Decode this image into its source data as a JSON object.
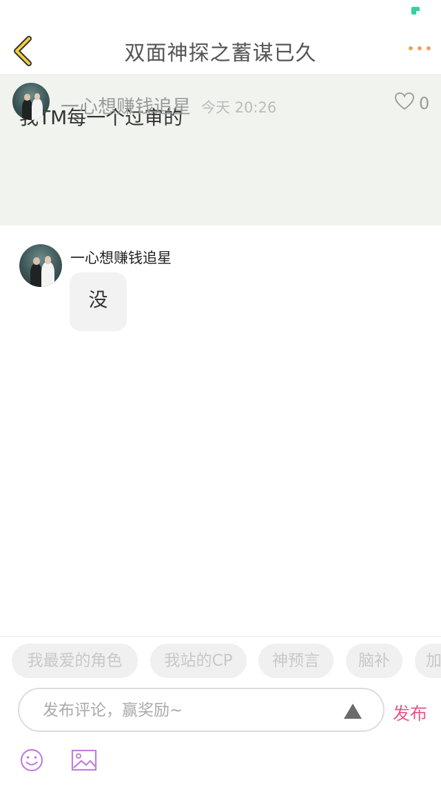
{
  "header": {
    "title": "双面神探之蓄谋已久",
    "back_icon": "chevron-left-icon",
    "more_icon": "more-dots-icon",
    "accent_color": "#e8c63a"
  },
  "post": {
    "text": "我TM每一个过审的",
    "author": "一心想赚钱追星",
    "time": "今天 20:26",
    "like_count": "0"
  },
  "comments": [
    {
      "author": "一心想赚钱追星",
      "text": "没"
    }
  ],
  "tags": [
    "我最爱的角色",
    "我站的CP",
    "神预言",
    "脑补",
    "加"
  ],
  "composer": {
    "placeholder": "发布评论，赢奖励~",
    "publish_label": "发布",
    "publish_color": "#e8578b",
    "emoji_icon": "smiley-icon",
    "image_icon": "image-icon"
  }
}
